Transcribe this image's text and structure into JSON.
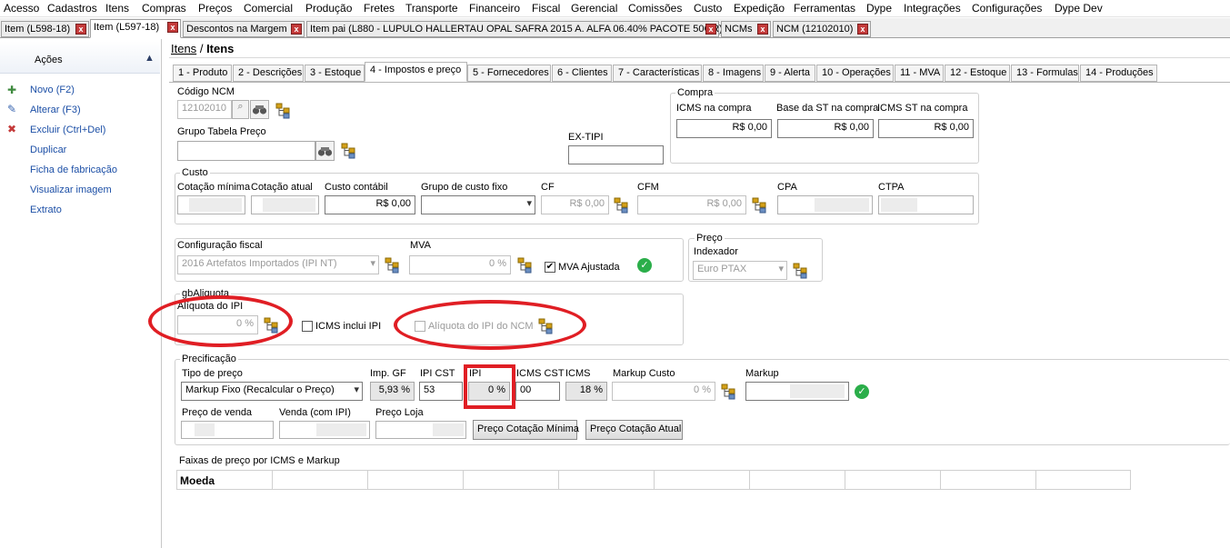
{
  "menu": [
    "Acesso",
    "Cadastros",
    "Itens",
    "Compras",
    "Preços",
    "Comercial",
    "Produção",
    "Fretes",
    "Transporte",
    "Financeiro",
    "Fiscal",
    "Gerencial",
    "Comissões",
    "Custo",
    "Expedição",
    "Ferramentas",
    "Dype",
    "Integrações",
    "Configurações",
    "Dype Dev"
  ],
  "doc_tabs": [
    {
      "label": "Item (L598-18)",
      "close": "x"
    },
    {
      "label": "Item (L597-18)",
      "close": "x"
    },
    {
      "label": "Descontos na Margem",
      "close": "x"
    },
    {
      "label": "Item pai (L880 - LUPULO HALLERTAU OPAL SAFRA 2015 A. ALFA 06.40% PACOTE 50GR)",
      "close": "x"
    },
    {
      "label": "NCMs",
      "close": "x"
    },
    {
      "label": "NCM (12102010)",
      "close": "x"
    }
  ],
  "left": {
    "title": "Ações",
    "collapse_icon": "▲",
    "actions": [
      "Novo (F2)",
      "Alterar (F3)",
      "Excluir (Ctrl+Del)",
      "Duplicar",
      "Ficha de fabricação",
      "Visualizar imagem",
      "Extrato"
    ]
  },
  "breadcrumb": {
    "link": "Itens",
    "sep": "/",
    "current": "Itens"
  },
  "inner_tabs": [
    "1 - Produto",
    "2 - Descrições",
    "3 - Estoque",
    "4 - Impostos e preço",
    "5 - Fornecedores",
    "6 - Clientes",
    "7 - Características",
    "8 - Imagens",
    "9 - Alerta",
    "10 - Operações",
    "11 - MVA",
    "12 - Estoque",
    "13 - Formulas",
    "14 - Produções"
  ],
  "ncm": {
    "label": "Código NCM",
    "value": "12102010"
  },
  "grupo_tabela": {
    "label": "Grupo Tabela Preço"
  },
  "ex_tipi": {
    "label": "EX-TIPI"
  },
  "compra": {
    "title": "Compra",
    "icms_label": "ICMS na compra",
    "icms_value": "R$ 0,00",
    "base_label": "Base da ST na compra",
    "base_value": "R$ 0,00",
    "icmsst_label": "ICMS ST na compra",
    "icmsst_value": "R$ 0,00"
  },
  "custo": {
    "title": "Custo",
    "cot_min": "Cotação mínima",
    "cot_atual": "Cotação atual",
    "custo_contabil": "Custo contábil",
    "custo_contabil_value": "R$ 0,00",
    "grupo_fixo": "Grupo de custo fixo",
    "cf": "CF",
    "cf_value": "R$ 0,00",
    "cfm": "CFM",
    "cfm_value": "R$ 0,00",
    "cpa": "CPA",
    "ctpa": "CTPA"
  },
  "fiscal": {
    "label": "Configuração fiscal",
    "value": "2016 Artefatos Importados (IPI NT)",
    "mva_label": "MVA",
    "mva_value": "0 %",
    "mva_ajustada": "MVA Ajustada"
  },
  "preco": {
    "title": "Preço",
    "indexador_label": "Indexador",
    "indexador_value": "Euro  PTAX"
  },
  "aliquota": {
    "group_title": "gbAliquota",
    "ipi_label": "Alíquota do IPI",
    "ipi_value": "0 %",
    "icms_inclui": "ICMS inclui IPI",
    "ipi_ncm": "Alíquota do IPI do NCM"
  },
  "precificacao": {
    "title": "Precificação",
    "tipo_label": "Tipo de preço",
    "tipo_value": "Markup Fixo (Recalcular o Preço)",
    "imp_gf_label": "Imp. GF",
    "imp_gf_value": "5,93 %",
    "ipi_cst_label": "IPI CST",
    "ipi_cst_value": "53",
    "ipi_label": "IPI",
    "ipi_value": "0 %",
    "icms_cst_label": "ICMS CST",
    "icms_cst_value": "00",
    "icms_label": "ICMS",
    "icms_value": "18 %",
    "markup_custo_label": "Markup Custo",
    "markup_custo_value": "0 %",
    "markup_label": "Markup",
    "preco_venda": "Preço de venda",
    "venda_ipi": "Venda (com IPI)",
    "preco_loja": "Preço Loja",
    "btn_min": "Preço Cotação Mínima",
    "btn_atual": "Preço Cotação Atual"
  },
  "faixas": {
    "label": "Faixas de preço por ICMS e Markup",
    "col_moeda": "Moeda"
  },
  "colors": {
    "accent_blue": "#1c4fa6",
    "close_red": "#c43a3a",
    "annotation_red": "#e01e24",
    "ok_green": "#2bae4a"
  }
}
